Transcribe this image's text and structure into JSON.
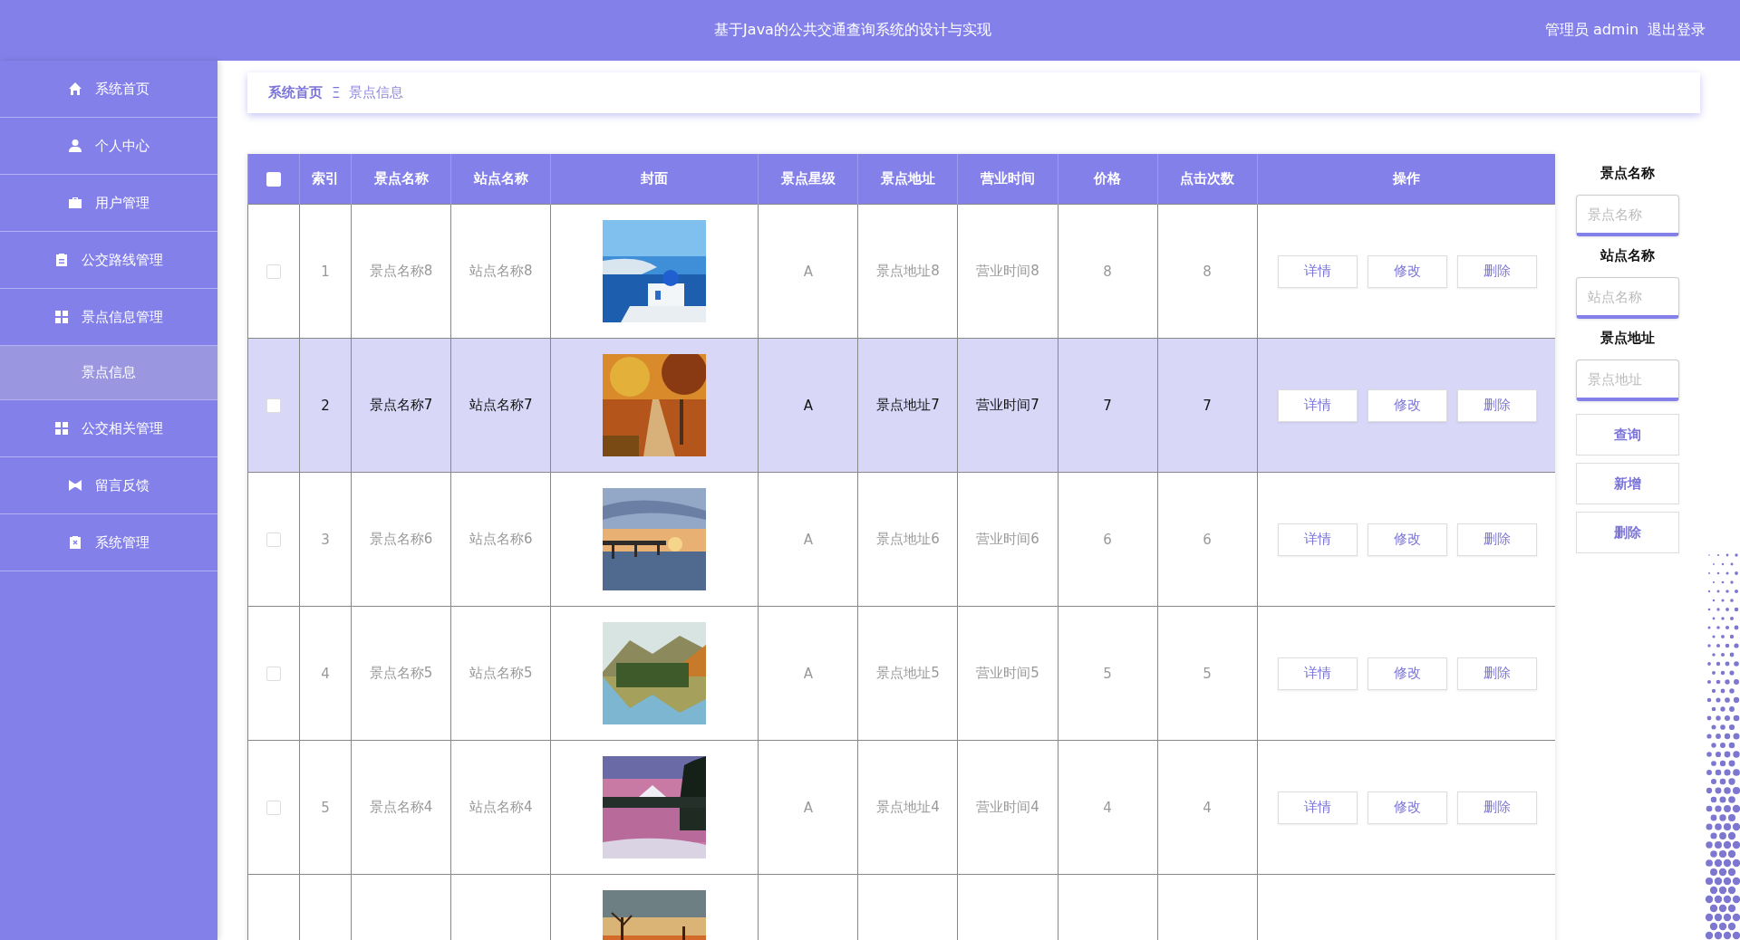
{
  "header": {
    "title": "基于Java的公共交通查询系统的设计与实现",
    "user": "管理员 admin",
    "logout": "退出登录"
  },
  "sidebar": {
    "items": [
      {
        "label": "系统首页",
        "kind": "menu",
        "selected": false
      },
      {
        "label": "个人中心",
        "kind": "menu",
        "selected": false
      },
      {
        "label": "用户管理",
        "kind": "menu",
        "selected": false
      },
      {
        "label": "公交路线管理",
        "kind": "menu",
        "selected": false
      },
      {
        "label": "景点信息管理",
        "kind": "menu",
        "selected": false
      },
      {
        "label": "景点信息",
        "kind": "submenu",
        "selected": true
      },
      {
        "label": "公交相关管理",
        "kind": "menu",
        "selected": false
      },
      {
        "label": "留言反馈",
        "kind": "menu",
        "selected": false
      },
      {
        "label": "系统管理",
        "kind": "menu",
        "selected": false
      }
    ]
  },
  "breadcrumb": {
    "home": "系统首页",
    "separator": "Ξ",
    "current": "景点信息"
  },
  "table": {
    "header_checkbox": {
      "checked": false
    },
    "columns": [
      "索引",
      "景点名称",
      "站点名称",
      "封面",
      "景点星级",
      "景点地址",
      "营业时间",
      "价格",
      "点击次数",
      "操作"
    ],
    "rows": [
      {
        "checked": false,
        "selected": false,
        "index": "1",
        "name": "景点名称8",
        "station": "站点名称8",
        "rating": "A",
        "address": "景点地址8",
        "hours": "营业时间8",
        "price": "8",
        "clicks": "8",
        "actions": [
          "详情",
          "修改",
          "删除"
        ]
      },
      {
        "checked": false,
        "selected": true,
        "index": "2",
        "name": "景点名称7",
        "station": "站点名称7",
        "rating": "A",
        "address": "景点地址7",
        "hours": "营业时间7",
        "price": "7",
        "clicks": "7",
        "actions": [
          "详情",
          "修改",
          "删除"
        ]
      },
      {
        "checked": false,
        "selected": false,
        "index": "3",
        "name": "景点名称6",
        "station": "站点名称6",
        "rating": "A",
        "address": "景点地址6",
        "hours": "营业时间6",
        "price": "6",
        "clicks": "6",
        "actions": [
          "详情",
          "修改",
          "删除"
        ]
      },
      {
        "checked": false,
        "selected": false,
        "index": "4",
        "name": "景点名称5",
        "station": "站点名称5",
        "rating": "A",
        "address": "景点地址5",
        "hours": "营业时间5",
        "price": "5",
        "clicks": "5",
        "actions": [
          "详情",
          "修改",
          "删除"
        ]
      },
      {
        "checked": false,
        "selected": false,
        "index": "5",
        "name": "景点名称4",
        "station": "站点名称4",
        "rating": "A",
        "address": "景点地址4",
        "hours": "营业时间4",
        "price": "4",
        "clicks": "4",
        "actions": [
          "详情",
          "修改",
          "删除"
        ]
      },
      {
        "selected": false
      }
    ]
  },
  "search_panel": {
    "fields": [
      {
        "label": "景点名称",
        "placeholder": "景点名称"
      },
      {
        "label": "站点名称",
        "placeholder": "站点名称"
      },
      {
        "label": "景点地址",
        "placeholder": "景点地址"
      }
    ],
    "buttons": [
      "查询",
      "新增",
      "删除"
    ]
  }
}
